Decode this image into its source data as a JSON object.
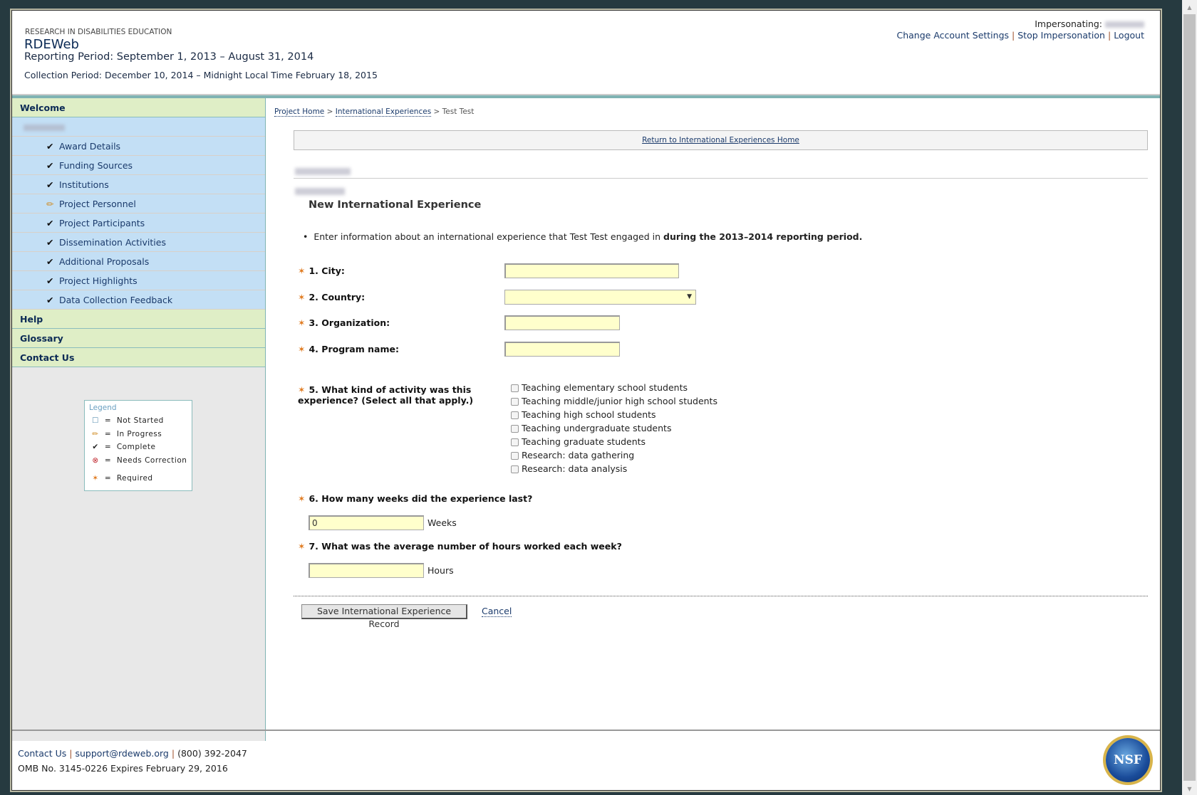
{
  "header": {
    "org": "RESEARCH IN DISABILITIES EDUCATION",
    "title": "RDEWeb",
    "reporting_period": "Reporting Period: September 1, 2013 – August 31, 2014",
    "collection_period": "Collection Period: December 10, 2014 – Midnight Local Time February 18, 2015",
    "impersonating_label": "Impersonating:",
    "links": {
      "settings": "Change Account Settings",
      "stop": "Stop Impersonation",
      "logout": "Logout"
    },
    "sep": "|"
  },
  "sidebar": {
    "welcome": "Welcome",
    "items": [
      {
        "label": "Award Details",
        "status": "complete"
      },
      {
        "label": "Funding Sources",
        "status": "complete"
      },
      {
        "label": "Institutions",
        "status": "complete"
      },
      {
        "label": "Project Personnel",
        "status": "in-progress"
      },
      {
        "label": "Project Participants",
        "status": "complete"
      },
      {
        "label": "Dissemination Activities",
        "status": "complete"
      },
      {
        "label": "Additional Proposals",
        "status": "complete"
      },
      {
        "label": "Project Highlights",
        "status": "complete"
      },
      {
        "label": "Data Collection Feedback",
        "status": "complete"
      }
    ],
    "help": "Help",
    "glossary": "Glossary",
    "contact": "Contact Us"
  },
  "legend": {
    "title": "Legend",
    "eq": "=",
    "items": [
      "Not Started",
      "In Progress",
      "Complete",
      "Needs Correction",
      "Required"
    ]
  },
  "breadcrumb": {
    "home": "Project Home",
    "section": "International Experiences",
    "current": "Test Test",
    "sep": ">"
  },
  "return_link": "Return to International Experiences Home",
  "form": {
    "heading": "New International Experience",
    "intro": "Enter information about an international experience that Test Test engaged in ",
    "intro_bold": "during the 2013–2014 reporting period.",
    "q1": "1. City:",
    "q2": "2. Country:",
    "q3": "3. Organization:",
    "q4": "4. Program name:",
    "q5": "5. What kind of activity was this experience? (Select all that apply.)",
    "q5_options": [
      "Teaching elementary school students",
      "Teaching middle/junior high school students",
      "Teaching high school students",
      "Teaching undergraduate students",
      "Teaching graduate students",
      "Research: data gathering",
      "Research: data analysis"
    ],
    "q6": "6. How many weeks did the experience last?",
    "weeks_value": "0",
    "weeks_unit": "Weeks",
    "q7": "7. What was the average number of hours worked each week?",
    "hours_value": "",
    "hours_unit": "Hours",
    "save": "Save International Experience Record",
    "cancel": "Cancel"
  },
  "footer": {
    "contact": "Contact Us",
    "email": "support@rdeweb.org",
    "phone": "(800) 392-2047",
    "omb": "OMB No. 3145-0226 Expires February 29, 2016",
    "logo": "NSF"
  },
  "colors": {
    "required": "#e07a1f",
    "nav_top": "#dfeec6",
    "nav_sub": "#c3dff5",
    "input": "#ffffcc"
  }
}
